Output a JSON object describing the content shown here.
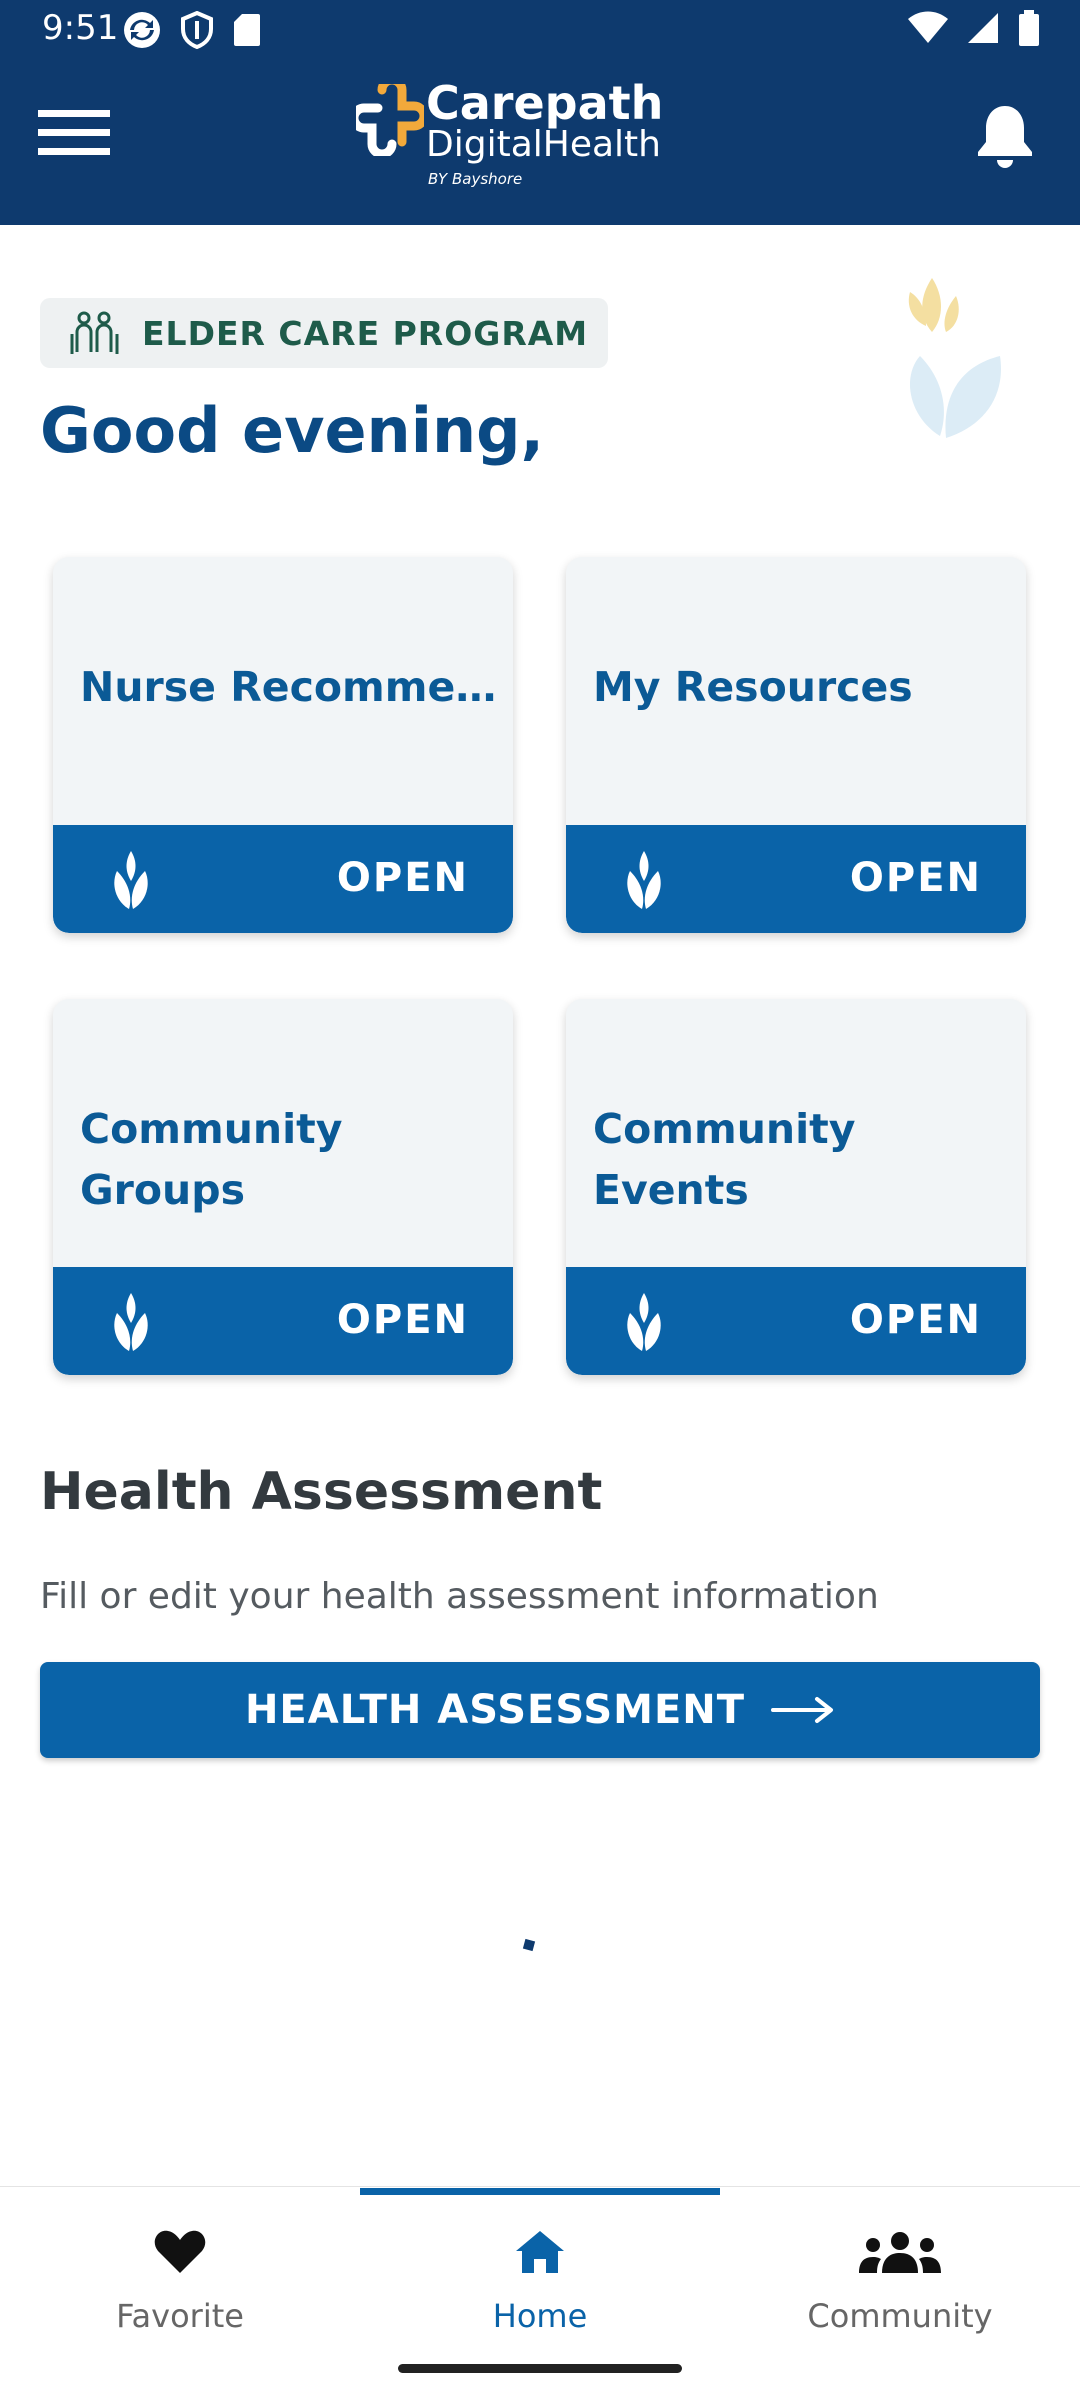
{
  "status_bar": {
    "time": "9:51"
  },
  "header": {
    "logo": {
      "line1": "Carepath",
      "line2": "DigitalHealth",
      "line3": "BY Bayshore"
    }
  },
  "program_badge": {
    "label": "ELDER CARE PROGRAM"
  },
  "greeting": "Good evening,",
  "cards": [
    {
      "title": "Nurse Recommendations",
      "action": "OPEN"
    },
    {
      "title": "My Resources",
      "action": "OPEN"
    },
    {
      "title": "Community Groups",
      "action": "OPEN"
    },
    {
      "title": "Community Events",
      "action": "OPEN"
    }
  ],
  "health_assessment": {
    "title": "Health Assessment",
    "description": "Fill or edit your health assessment information",
    "button_label": "HEALTH ASSESSMENT"
  },
  "bottom_nav": {
    "items": [
      {
        "label": "Favorite",
        "icon": "heart-icon"
      },
      {
        "label": "Home",
        "icon": "home-icon"
      },
      {
        "label": "Community",
        "icon": "people-icon"
      }
    ],
    "active": "Home"
  },
  "colors": {
    "header_bg": "#0e3a6e",
    "primary": "#0a63a8",
    "card_bg": "#f2f5f7",
    "greeting": "#0b4a84",
    "badge_text": "#1e5b4a"
  }
}
